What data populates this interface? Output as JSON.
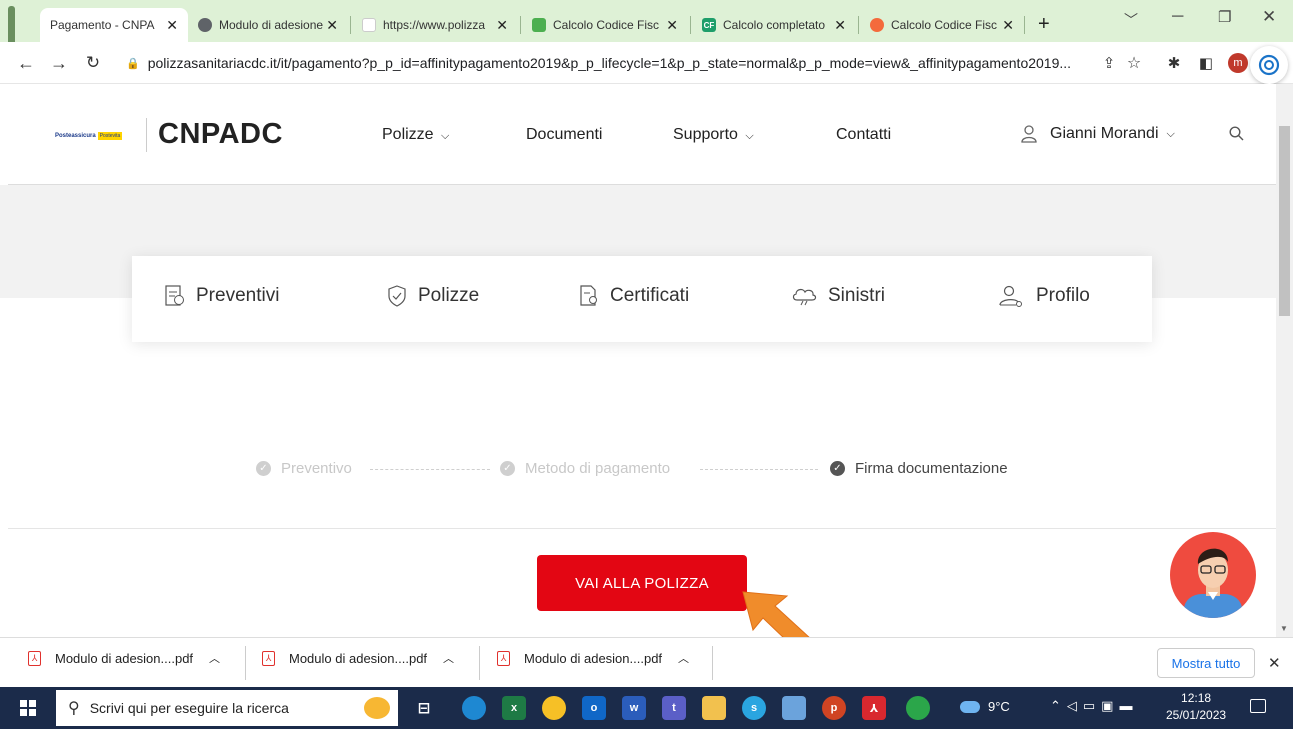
{
  "browser": {
    "tabs": [
      {
        "title": "Pagamento - CNPA",
        "active": true,
        "favicon_color": "#e8e8e8"
      },
      {
        "title": "Modulo di adesione",
        "active": false,
        "favicon_color": "#5f6368"
      },
      {
        "title": "https://www.polizza",
        "active": false,
        "favicon_color": "#ffffff"
      },
      {
        "title": "Calcolo Codice Fisc",
        "active": false,
        "favicon_color": "#4caf50"
      },
      {
        "title": "Calcolo completato",
        "active": false,
        "favicon_color": "#1e9e6a",
        "favicon_text": "CF"
      },
      {
        "title": "Calcolo Codice Fisc",
        "active": false,
        "favicon_color": "#f46a3c"
      }
    ],
    "new_tab_label": "+",
    "url": "polizzasanitariacdc.it/it/pagamento?p_p_id=affinitypagamento2019&p_p_lifecycle=1&p_p_state=normal&p_p_mode=view&_affinitypagamento2019...",
    "profile_initial": "m"
  },
  "site": {
    "logo_small": "Posteassicura",
    "logo_small_tag": "Postevita",
    "brand": "CNPADC",
    "nav": [
      "Polizze",
      "Documenti",
      "Supporto",
      "Contatti"
    ],
    "user": "Gianni Morandi",
    "quick_links": [
      "Preventivi",
      "Polizze",
      "Certificati",
      "Sinistri",
      "Profilo"
    ],
    "steps": [
      "Preventivo",
      "Metodo di pagamento",
      "Firma documentazione"
    ],
    "cta": "VAI ALLA POLIZZA"
  },
  "downloads": {
    "items": [
      "Modulo di adesion....pdf",
      "Modulo di adesion....pdf",
      "Modulo di adesion....pdf"
    ],
    "show_all": "Mostra tutto"
  },
  "taskbar": {
    "search_placeholder": "Scrivi qui per eseguire la ricerca",
    "temperature": "9°C",
    "time": "12:18",
    "date": "25/01/2023"
  },
  "colors": {
    "accent_red": "#e30613",
    "tabbar": "#def1d6",
    "taskbar": "#1b2b4a"
  }
}
